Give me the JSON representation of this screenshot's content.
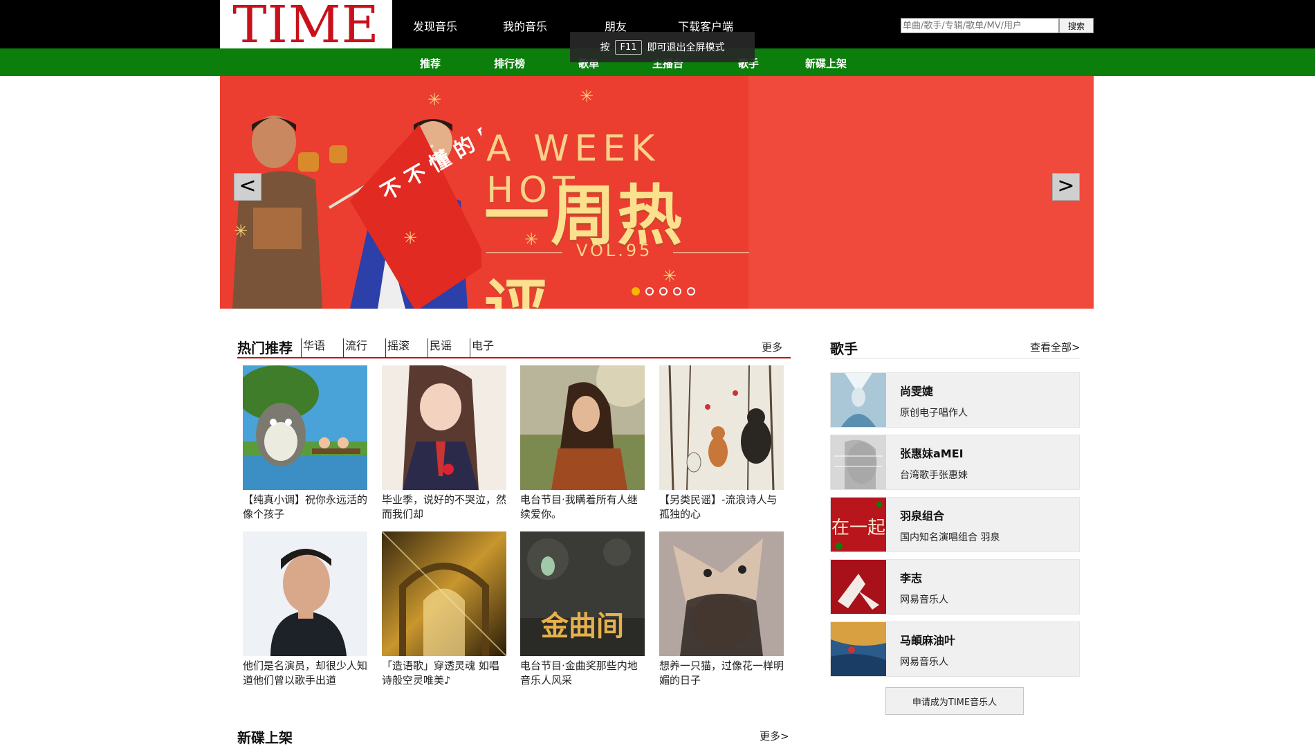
{
  "logo": {
    "text": "TIME"
  },
  "topnav": {
    "items": [
      "发现音乐",
      "我的音乐",
      "朋友",
      "下载客户端"
    ]
  },
  "search": {
    "placeholder": "单曲/歌手/专辑/歌单/MV/用户",
    "button": "搜索"
  },
  "subnav": {
    "items": [
      "推荐",
      "排行榜",
      "歌单",
      "主播台",
      "歌手",
      "新碟上架"
    ]
  },
  "f11_tip": {
    "pre": "按",
    "key": "F11",
    "post": "即可退出全屏模式"
  },
  "banner": {
    "title": "A WEEK HOT",
    "subtitle": "一周热评",
    "vol": "VOL.95",
    "flag": "不 不 懂 的 后 励 志 路 发 手 歌 新",
    "prev": "<",
    "next": ">",
    "dots": 5,
    "active_dot": 0
  },
  "hot": {
    "title": "热门推荐",
    "tabs": [
      "华语",
      "流行",
      "摇滚",
      "民谣",
      "电子"
    ],
    "more": "更多",
    "cards": [
      {
        "caption": "【纯真小调】祝你永远活的像个孩子"
      },
      {
        "caption": "毕业季，说好的不哭泣，然而我们却"
      },
      {
        "caption": "电台节目·我瞒着所有人继续爱你。"
      },
      {
        "caption": "【另类民谣】-流浪诗人与孤独的心"
      },
      {
        "caption": "他们是名演员，却很少人知道他们曾以歌手出道"
      },
      {
        "caption": "「造语歌」穿透灵魂 如唱诗般空灵唯美♪"
      },
      {
        "caption": "电台节目·金曲奖那些内地音乐人风采"
      },
      {
        "caption": "想养一只猫，过像花一样明媚的日子"
      }
    ],
    "card4_text": "金曲间"
  },
  "newalbum": {
    "title": "新碟上架",
    "more": "更多>"
  },
  "singers": {
    "title": "歌手",
    "more": "查看全部>",
    "items": [
      {
        "name": "尚雯婕",
        "desc": "原创电子唱作人"
      },
      {
        "name": "张惠妹aMEI",
        "desc": "台湾歌手张惠妹"
      },
      {
        "name": "羽泉组合",
        "desc": "国内知名演唱组合 羽泉"
      },
      {
        "name": "李志",
        "desc": "网易音乐人"
      },
      {
        "name": "马頔麻油叶",
        "desc": "网易音乐人"
      }
    ],
    "pic_text_2": "在一起",
    "apply": "申请成为TIME音乐人"
  }
}
